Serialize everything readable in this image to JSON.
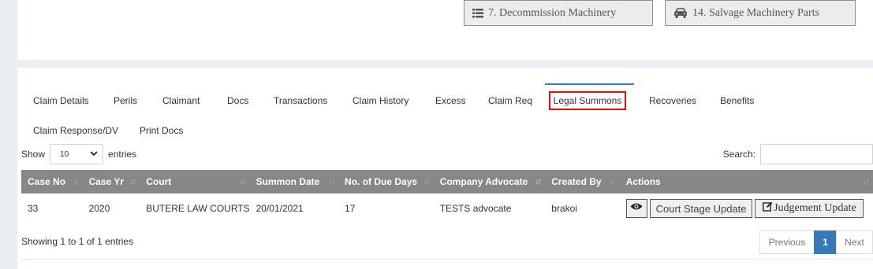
{
  "top_buttons": {
    "decommission": "7. Decommission Machinery",
    "salvage": "14. Salvage Machinery Parts"
  },
  "tabs": [
    {
      "label": "Claim Details"
    },
    {
      "label": "Perils"
    },
    {
      "label": "Claimant"
    },
    {
      "label": "Docs"
    },
    {
      "label": "Transactions"
    },
    {
      "label": "Claim History"
    },
    {
      "label": "Excess"
    },
    {
      "label": "Claim Req"
    },
    {
      "label": "Legal Summons"
    },
    {
      "label": "Recoveries"
    },
    {
      "label": "Benefits"
    },
    {
      "label": "Claim Response/DV"
    },
    {
      "label": "Print Docs"
    }
  ],
  "active_tab": "Legal Summons",
  "length_menu": {
    "prefix": "Show",
    "value": "10",
    "suffix": "entries"
  },
  "search": {
    "label": "Search:",
    "value": ""
  },
  "table": {
    "columns": [
      "Case No",
      "Case Yr",
      "Court",
      "Summon Date",
      "No. of Due Days",
      "Company Advocate",
      "Created By",
      "Actions"
    ],
    "rows": [
      {
        "case_no": "33",
        "case_yr": "2020",
        "court": "BUTERE LAW COURTS",
        "summon_date": "20/01/2021",
        "due_days": "17",
        "advocate": "TESTS advocate",
        "created_by": "brakoi"
      }
    ],
    "actions": {
      "stage_label": "Court Stage Update",
      "judgement_label": "Judgement Update"
    }
  },
  "info_text": "Showing 1 to 1 of 1 entries",
  "pagination": {
    "previous": "Previous",
    "current": "1",
    "next": "Next"
  },
  "colors": {
    "header_bg": "#878787",
    "active_tab_border": "#2f7fc1",
    "highlight_box": "#e01010",
    "page_current": "#337ab7"
  }
}
